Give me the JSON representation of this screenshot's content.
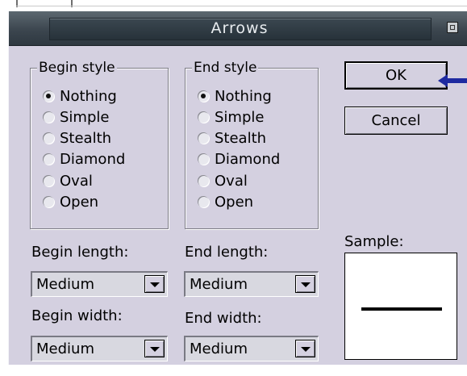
{
  "dialog": {
    "title": "Arrows",
    "ok_label": "OK",
    "cancel_label": "Cancel",
    "begin_style": {
      "label": "Begin style",
      "options": [
        "Nothing",
        "Simple",
        "Stealth",
        "Diamond",
        "Oval",
        "Open"
      ],
      "selected": "Nothing"
    },
    "end_style": {
      "label": "End style",
      "options": [
        "Nothing",
        "Simple",
        "Stealth",
        "Diamond",
        "Oval",
        "Open"
      ],
      "selected": "Nothing"
    },
    "begin_length": {
      "label": "Begin length:",
      "value": "Medium"
    },
    "end_length": {
      "label": "End length:",
      "value": "Medium"
    },
    "begin_width": {
      "label": "Begin width:",
      "value": "Medium"
    },
    "end_width": {
      "label": "End width:",
      "value": "Medium"
    },
    "sample_label": "Sample:"
  },
  "colors": {
    "dialog_bg": "#d4d0e0",
    "titlebar": "#3c464f",
    "title_text": "#e8ecef",
    "pointer_arrow": "#1e2aa0"
  },
  "icons": [
    "close-icon",
    "radio-icon",
    "chevron-down-icon",
    "pointer-arrow-icon"
  ]
}
